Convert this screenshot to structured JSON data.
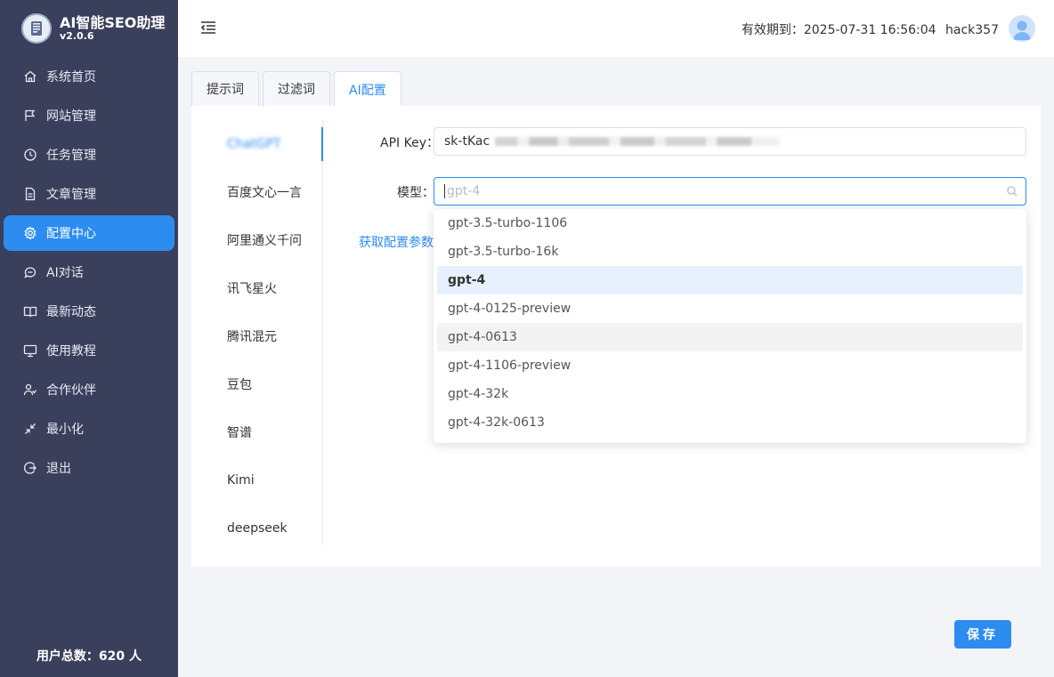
{
  "brand": {
    "title": "AI智能SEO助理",
    "version": "v2.0.6",
    "logo_icon": "book-icon"
  },
  "sidebar": {
    "items": [
      {
        "label": "系统首页",
        "icon": "home-icon"
      },
      {
        "label": "网站管理",
        "icon": "flag-icon"
      },
      {
        "label": "任务管理",
        "icon": "clock-icon"
      },
      {
        "label": "文章管理",
        "icon": "document-icon"
      },
      {
        "label": "配置中心",
        "icon": "gear-icon",
        "active": true
      },
      {
        "label": "AI对话",
        "icon": "chat-icon"
      },
      {
        "label": "最新动态",
        "icon": "book-open-icon"
      },
      {
        "label": "使用教程",
        "icon": "monitor-icon"
      },
      {
        "label": "合作伙伴",
        "icon": "users-icon"
      },
      {
        "label": "最小化",
        "icon": "minimize-icon"
      },
      {
        "label": "退出",
        "icon": "logout-icon"
      }
    ],
    "user_count": "用户总数：620 人"
  },
  "header": {
    "expiry": "有效期到：2025-07-31 16:56:04",
    "username": "hack357",
    "menu_icon": "menu-fold-icon",
    "avatar_icon": "user-avatar-icon"
  },
  "tabs": [
    {
      "label": "提示词"
    },
    {
      "label": "过滤词"
    },
    {
      "label": "AI配置",
      "active": true
    }
  ],
  "providers": [
    {
      "label": "ChatGPT",
      "active": true,
      "obscured": true
    },
    {
      "label": "百度文心一言"
    },
    {
      "label": "阿里通义千问"
    },
    {
      "label": "讯飞星火"
    },
    {
      "label": "腾讯混元"
    },
    {
      "label": "豆包"
    },
    {
      "label": "智谱"
    },
    {
      "label": "Kimi"
    },
    {
      "label": "deepseek"
    }
  ],
  "form": {
    "api_key_label": "API Key：",
    "api_key_value": "sk-tKac",
    "model_label": "模型：",
    "model_placeholder": "gpt-4",
    "config_link": "获取配置参数"
  },
  "model_options": [
    {
      "label": "gpt-3.5-turbo-1106"
    },
    {
      "label": "gpt-3.5-turbo-16k"
    },
    {
      "label": "gpt-4",
      "selected": true
    },
    {
      "label": "gpt-4-0125-preview"
    },
    {
      "label": "gpt-4-0613",
      "hover": true
    },
    {
      "label": "gpt-4-1106-preview"
    },
    {
      "label": "gpt-4-32k"
    },
    {
      "label": "gpt-4-32k-0613"
    }
  ],
  "save_label": "保存",
  "colors": {
    "accent": "#2d8cf0",
    "sidebar_bg": "#3a3f5c",
    "page_bg": "#f3f4f7"
  }
}
